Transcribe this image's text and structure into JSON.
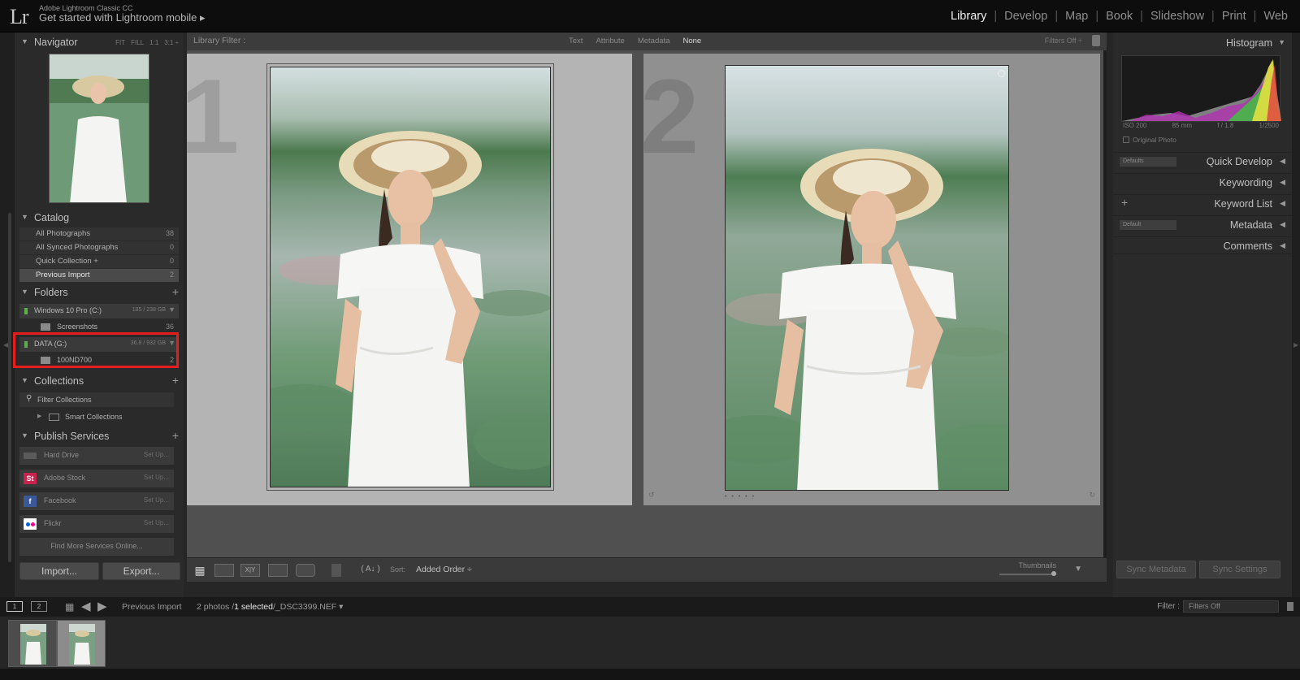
{
  "identity": {
    "logo": "Lr",
    "product": "Adobe Lightroom Classic CC",
    "tagline": "Get started with Lightroom mobile ▸"
  },
  "modules": [
    "Library",
    "Develop",
    "Map",
    "Book",
    "Slideshow",
    "Print",
    "Web"
  ],
  "active_module": "Library",
  "navigator": {
    "title": "Navigator",
    "options": [
      "FIT",
      "FILL",
      "1:1",
      "3:1 ÷"
    ]
  },
  "catalog": {
    "title": "Catalog",
    "items": [
      {
        "label": "All Photographs",
        "count": "38"
      },
      {
        "label": "All Synced Photographs",
        "count": "0"
      },
      {
        "label": "Quick Collection +",
        "count": "0"
      },
      {
        "label": "Previous Import",
        "count": "2"
      }
    ]
  },
  "folders": {
    "title": "Folders",
    "volume1": {
      "label": "Windows 10 Pro (C:)",
      "size": "185 / 238 GB"
    },
    "folder1": {
      "label": "Screenshots",
      "count": "36"
    },
    "volume2": {
      "label": "DATA (G:)",
      "size": "36.8 / 932 GB"
    },
    "folder2": {
      "label": "100ND700",
      "count": "2"
    }
  },
  "collections": {
    "title": "Collections",
    "filter": "Filter Collections",
    "smart": "Smart Collections"
  },
  "publish": {
    "title": "Publish Services",
    "services": [
      {
        "label": "Hard Drive",
        "action": "Set Up..."
      },
      {
        "label": "Adobe Stock",
        "action": "Set Up..."
      },
      {
        "label": "Facebook",
        "action": "Set Up..."
      },
      {
        "label": "Flickr",
        "action": "Set Up..."
      }
    ],
    "find_more": "Find More Services Online..."
  },
  "buttons": {
    "import": "Import...",
    "export": "Export..."
  },
  "library_filter": {
    "label": "Library Filter :",
    "tabs": [
      "Text",
      "Attribute",
      "Metadata",
      "None"
    ],
    "active": "None",
    "filters_off": "Filters Off ÷"
  },
  "grid": {
    "cell1_number": "1",
    "cell2_number": "2",
    "stars": "• • • • •"
  },
  "toolbar": {
    "sort_label": "Sort:",
    "sort_value": "Added Order ÷",
    "thumbnails_label": "Thumbnails"
  },
  "right_panel": {
    "histogram": "Histogram",
    "exif": [
      "ISO 200",
      "85 mm",
      "f / 1.8",
      "1/2500"
    ],
    "original_photo": "Original Photo",
    "quick_develop": "Quick Develop",
    "quick_develop_preset": "Defaults",
    "keywording": "Keywording",
    "keyword_list": "Keyword List",
    "metadata": "Metadata",
    "metadata_preset": "Default",
    "comments": "Comments",
    "sync_metadata": "Sync Metadata",
    "sync_settings": "Sync Settings"
  },
  "filmstrip_bar": {
    "screen1": "1",
    "screen2": "2",
    "source": "Previous Import",
    "count_prefix": "2 photos /",
    "count_selected": "1 selected",
    "count_suffix": "/_DSC3399.NEF ▾",
    "filter_label": "Filter :",
    "filter_value": "Filters Off"
  }
}
